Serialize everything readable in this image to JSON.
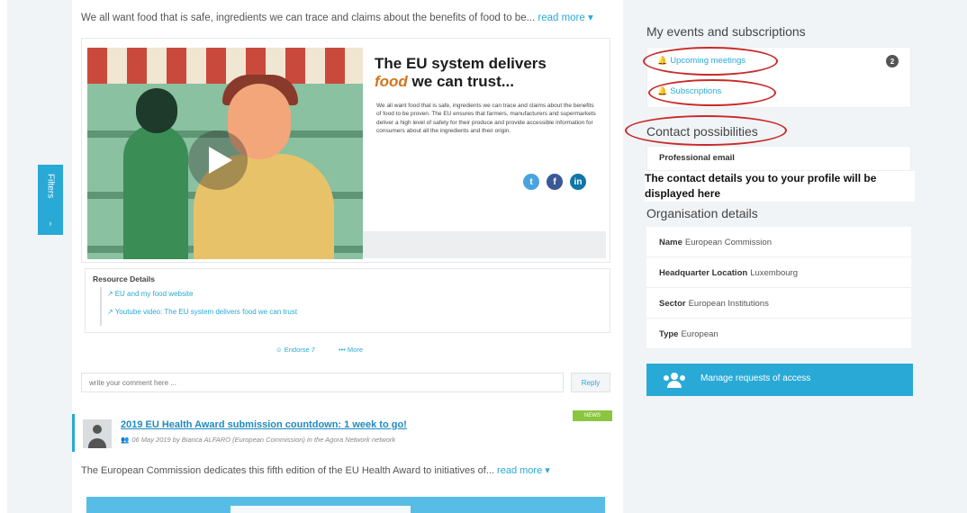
{
  "filters_tab": {
    "label": "Filters"
  },
  "post1": {
    "intro": "We all want food that is safe, ingredients we can trace and claims about the benefits of food to be...",
    "read_more": "read more ▾",
    "video": {
      "title_line1": "The EU system delivers",
      "title_food": "food",
      "title_rest": " we can trust...",
      "description": "We all want food that is safe, ingredients we can trace and claims about the benefits of food to be proven. The EU ensures that farmers, manufacturers and supermarkets deliver a high level of safety for their produce and provide accessible information for consumers about all the ingredients and their origin.",
      "social": [
        "twitter-icon",
        "facebook-icon",
        "linkedin-icon"
      ]
    },
    "resource": {
      "title": "Resource Details",
      "links": [
        "EU and my food website",
        "Youtube video: The EU system delivers food we can trust"
      ]
    },
    "endorse": "☺ Endorse",
    "endorse_count": "7",
    "more": "••• More",
    "comment_placeholder": "write your comment here ...",
    "reply": "Reply"
  },
  "post2": {
    "badge": "NEWS",
    "title": "2019 EU Health Award submission countdown: 1 week to go!",
    "meta": "06 May 2019 by Bianca ALFARO (European Commission) in the Agora Network network",
    "excerpt": "The European Commission dedicates this fifth edition of the EU Health Award to initiatives of...",
    "read_more": "read more ▾"
  },
  "sidebar": {
    "events_heading": "My events and subscriptions",
    "upcoming_meetings": "Upcoming meetings",
    "upcoming_count": "2",
    "subscriptions": "Subscriptions",
    "contact_heading": "Contact possibilities",
    "professional_email": "Professional email",
    "contact_note": "The contact details you to your profile will be displayed here",
    "org_heading": "Organisation details",
    "org_rows": [
      {
        "label": "Name",
        "value": "European Commission"
      },
      {
        "label": "Headquarter Location",
        "value": "Luxembourg"
      },
      {
        "label": "Sector",
        "value": "European Institutions"
      },
      {
        "label": "Type",
        "value": "European"
      }
    ],
    "manage_requests": "Manage requests of access"
  },
  "colors": {
    "accent": "#29a9d6",
    "annotation": "#c92a2a",
    "news": "#8cc63f"
  }
}
